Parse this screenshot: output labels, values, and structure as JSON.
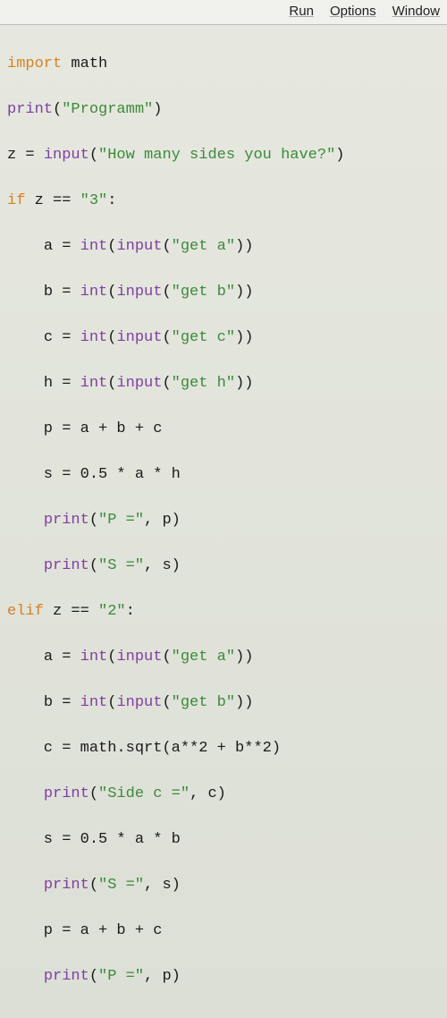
{
  "menu": {
    "run": "Run",
    "options": "Options",
    "window": "Window"
  },
  "code": {
    "l1": {
      "kw": "import",
      "rest": " math"
    },
    "l2": {
      "fn": "print",
      "o": "(",
      "s": "\"Programm\"",
      "c": ")"
    },
    "l3": {
      "pre": "z = ",
      "fn": "input",
      "o": "(",
      "s": "\"How many sides you have?\"",
      "c": ")"
    },
    "l4": {
      "kw": "if",
      "mid": " z == ",
      "s": "\"3\"",
      "col": ":"
    },
    "l5": {
      "ind": "    ",
      "pre": "a = ",
      "fn1": "int",
      "o1": "(",
      "fn2": "input",
      "o2": "(",
      "s": "\"get a\"",
      "c": "))"
    },
    "l6": {
      "ind": "    ",
      "pre": "b = ",
      "fn1": "int",
      "o1": "(",
      "fn2": "input",
      "o2": "(",
      "s": "\"get b\"",
      "c": "))"
    },
    "l7": {
      "ind": "    ",
      "pre": "c = ",
      "fn1": "int",
      "o1": "(",
      "fn2": "input",
      "o2": "(",
      "s": "\"get c\"",
      "c": "))"
    },
    "l8": {
      "ind": "    ",
      "pre": "h = ",
      "fn1": "int",
      "o1": "(",
      "fn2": "input",
      "o2": "(",
      "s": "\"get h\"",
      "c": "))"
    },
    "l9": {
      "txt": "    p = a + b + c"
    },
    "l10": {
      "txt": "    s = 0.5 * a * h"
    },
    "l11": {
      "ind": "    ",
      "fn": "print",
      "o": "(",
      "s": "\"P =\"",
      "rest": ", p)"
    },
    "l12": {
      "ind": "    ",
      "fn": "print",
      "o": "(",
      "s": "\"S =\"",
      "rest": ", s)"
    },
    "l13": {
      "kw": "elif",
      "mid": " z == ",
      "s": "\"2\"",
      "col": ":"
    },
    "l14": {
      "ind": "    ",
      "pre": "a = ",
      "fn1": "int",
      "o1": "(",
      "fn2": "input",
      "o2": "(",
      "s": "\"get a\"",
      "c": "))"
    },
    "l15": {
      "ind": "    ",
      "pre": "b = ",
      "fn1": "int",
      "o1": "(",
      "fn2": "input",
      "o2": "(",
      "s": "\"get b\"",
      "c": "))"
    },
    "l16": {
      "txt": "    c = math.sqrt(a**2 + b**2)"
    },
    "l17": {
      "ind": "    ",
      "fn": "print",
      "o": "(",
      "s": "\"Side c =\"",
      "rest": ", c)"
    },
    "l18": {
      "txt": "    s = 0.5 * a * b"
    },
    "l19": {
      "ind": "    ",
      "fn": "print",
      "o": "(",
      "s": "\"S =\"",
      "rest": ", s)"
    },
    "l20": {
      "txt": "    p = a + b + c"
    },
    "l21": {
      "ind": "    ",
      "fn": "print",
      "o": "(",
      "s": "\"P =\"",
      "rest": ", p)"
    }
  }
}
